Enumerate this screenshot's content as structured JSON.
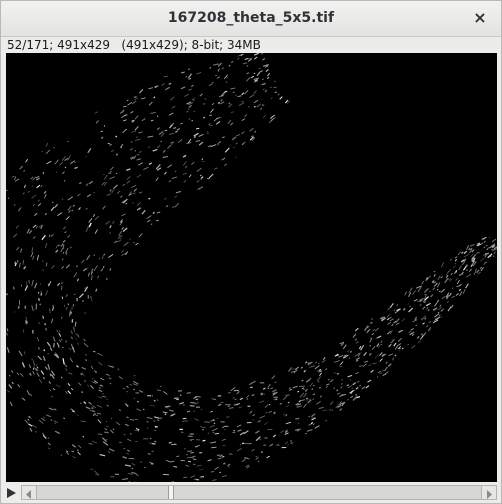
{
  "window": {
    "title": "167208_theta_5x5.tif",
    "close_glyph": "×"
  },
  "image_info": {
    "text": "52/171; 491x429   (491x429); 8-bit; 34MB"
  },
  "slice_slider": {
    "current": 52,
    "total": 171
  },
  "icons": {
    "close": "close-icon",
    "play": "play-icon",
    "scroll_left": "arrow-left-icon",
    "scroll_right": "arrow-right-icon"
  },
  "colors": {
    "canvas_background": "#000000",
    "signal": "#ffffff"
  }
}
